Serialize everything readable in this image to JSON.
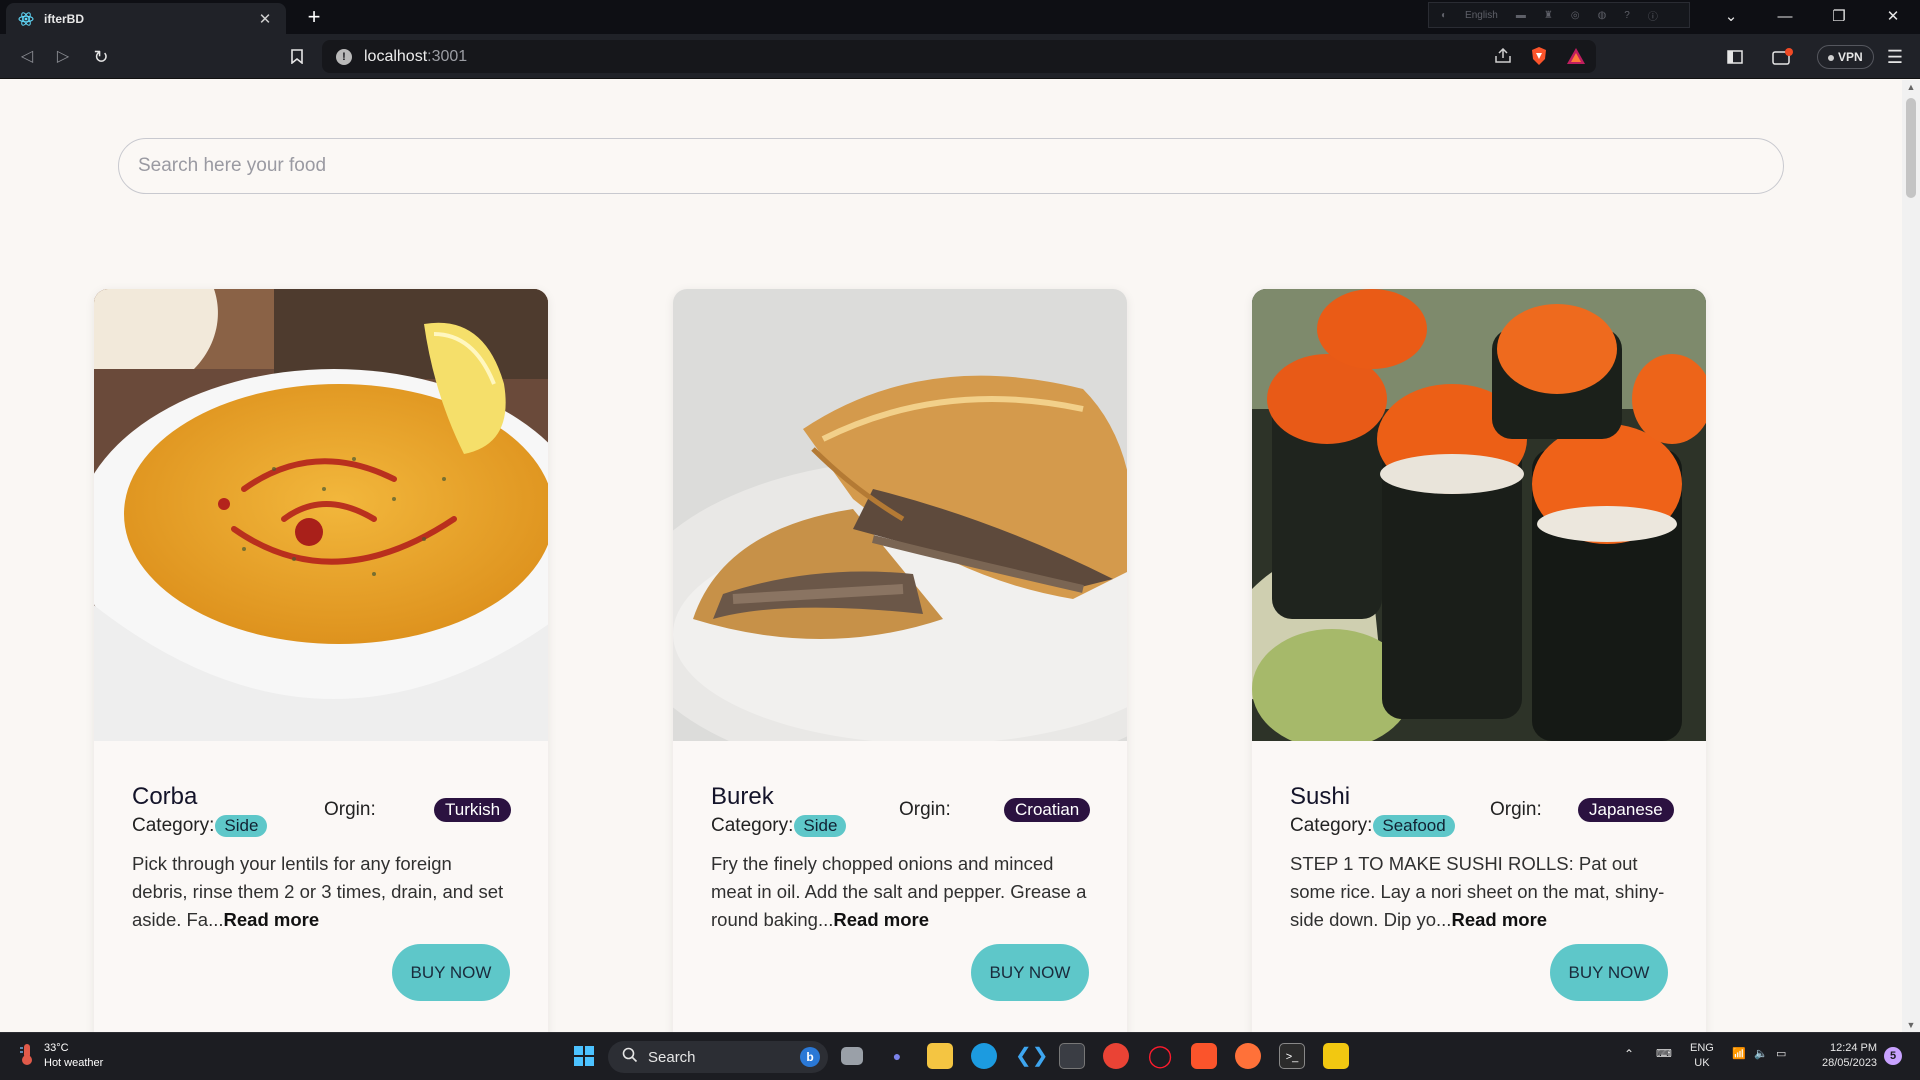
{
  "browser": {
    "tab_title": "ifterBD",
    "tab_close": "✕",
    "new_tab": "+",
    "language_indicator": "English",
    "address_host": "localhost",
    "address_port": ":3001",
    "vpn_label": "VPN",
    "window": {
      "minimize": "—",
      "restore": "❐",
      "close": "✕"
    }
  },
  "search": {
    "placeholder": "Search here your food",
    "value": ""
  },
  "labels": {
    "category": "Category:",
    "origin": "Orgin:",
    "read_more": "Read more",
    "buy_now": "BUY NOW"
  },
  "foods": [
    {
      "name": "Corba",
      "category": "Side",
      "origin": "Turkish",
      "description": "Pick through your lentils for any foreign debris, rinse them 2 or 3 times, drain, and set aside. Fa..."
    },
    {
      "name": "Burek",
      "category": "Side",
      "origin": "Croatian",
      "description": "Fry the finely chopped onions and minced meat in oil. Add the salt and pepper. Grease a round baking..."
    },
    {
      "name": "Sushi",
      "category": "Seafood",
      "origin": "Japanese",
      "description": "STEP 1 TO MAKE SUSHI ROLLS: Pat out some rice. Lay a nori sheet on the mat, shiny-side down. Dip yo..."
    }
  ],
  "taskbar": {
    "temperature": "33°C",
    "weather": "Hot weather",
    "search_label": "Search",
    "language": "ENG",
    "region": "UK",
    "time": "12:24 PM",
    "date": "28/05/2023"
  },
  "colors": {
    "accent_teal": "#5ec7c9",
    "origin_badge": "#2b1240",
    "page_background": "#faf7f4"
  }
}
